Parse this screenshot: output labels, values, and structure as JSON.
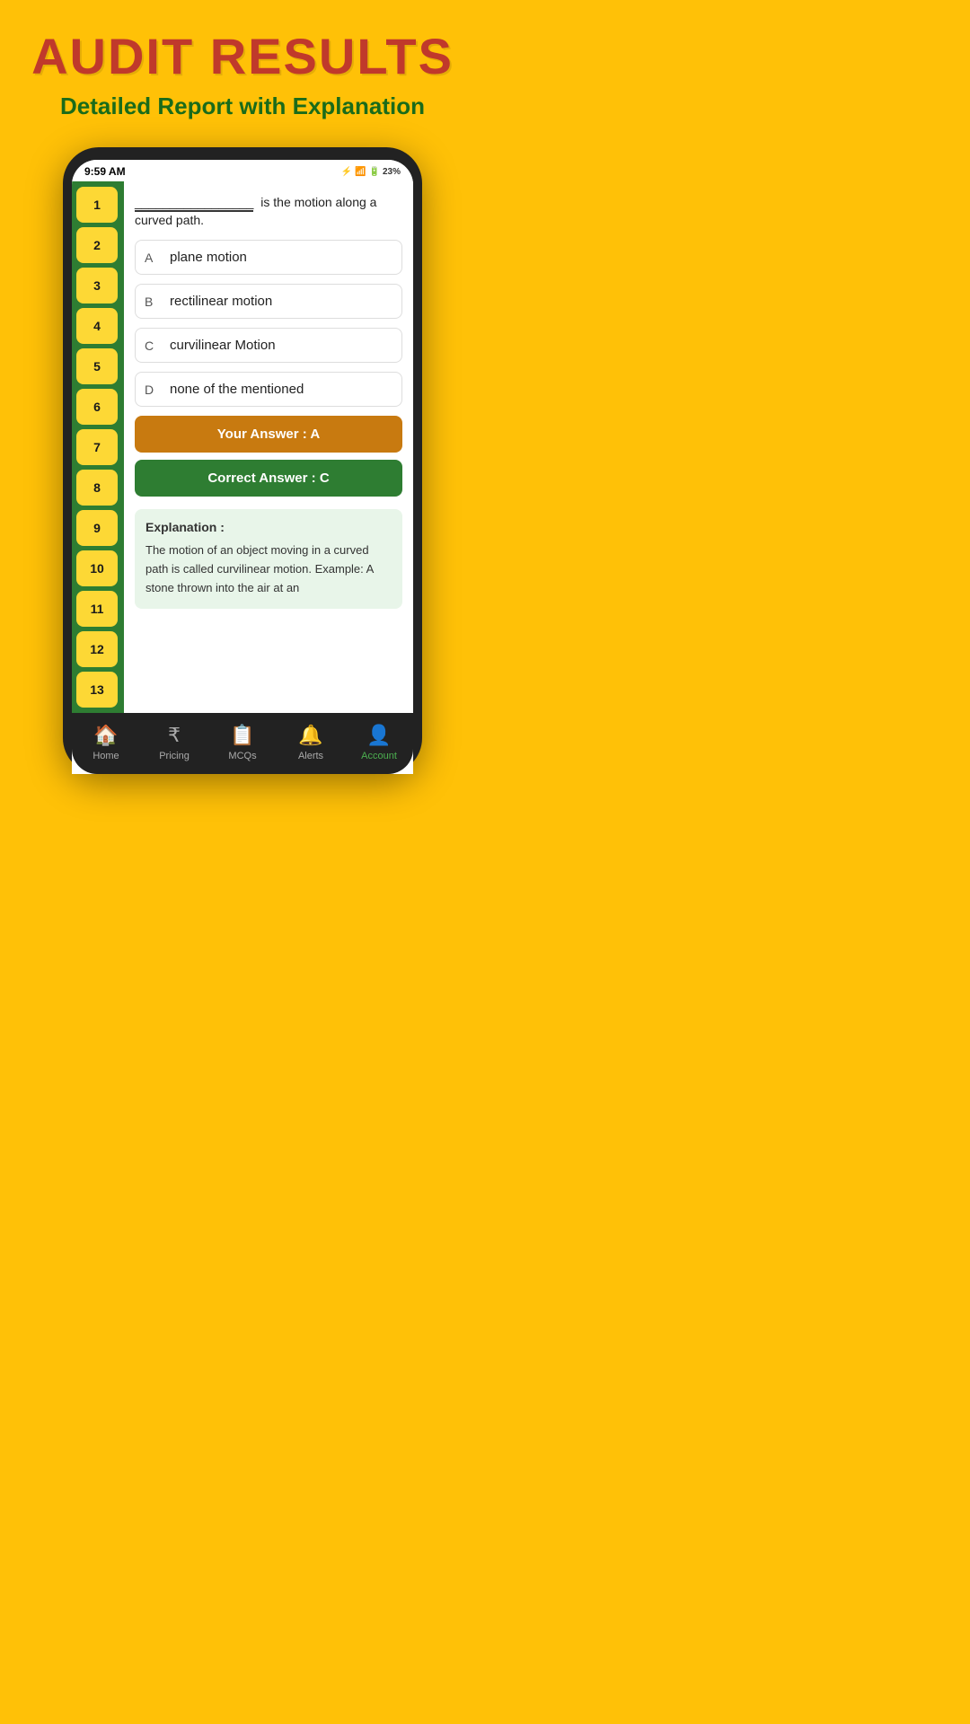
{
  "header": {
    "title": "AUDIT RESULTS",
    "subtitle": "Detailed Report with Explanation"
  },
  "statusBar": {
    "time": "9:59 AM",
    "battery": "23%"
  },
  "sidebar": {
    "items": [
      {
        "number": "1"
      },
      {
        "number": "2"
      },
      {
        "number": "3"
      },
      {
        "number": "4"
      },
      {
        "number": "5"
      },
      {
        "number": "6"
      },
      {
        "number": "7"
      },
      {
        "number": "8"
      },
      {
        "number": "9"
      },
      {
        "number": "10"
      },
      {
        "number": "11"
      },
      {
        "number": "12"
      },
      {
        "number": "13"
      }
    ]
  },
  "question": {
    "prefix": "_________________",
    "text": " is the motion along a curved path."
  },
  "options": [
    {
      "letter": "A",
      "text": "plane motion"
    },
    {
      "letter": "B",
      "text": "rectilinear motion"
    },
    {
      "letter": "C",
      "text": "curvilinear Motion"
    },
    {
      "letter": "D",
      "text": "none of the mentioned"
    }
  ],
  "answers": {
    "your_answer_label": "Your Answer : A",
    "correct_answer_label": "Correct Answer : C"
  },
  "explanation": {
    "title": "Explanation :",
    "text": "The motion of an object moving in a curved path is called curvilinear motion. Example: A stone thrown into the air at an"
  },
  "bottomNav": {
    "items": [
      {
        "icon": "🏠",
        "label": "Home",
        "active": false
      },
      {
        "icon": "₹",
        "label": "Pricing",
        "active": false
      },
      {
        "icon": "📋",
        "label": "MCQs",
        "active": false
      },
      {
        "icon": "🔔",
        "label": "Alerts",
        "active": false
      },
      {
        "icon": "👤",
        "label": "Account",
        "active": true
      }
    ]
  }
}
